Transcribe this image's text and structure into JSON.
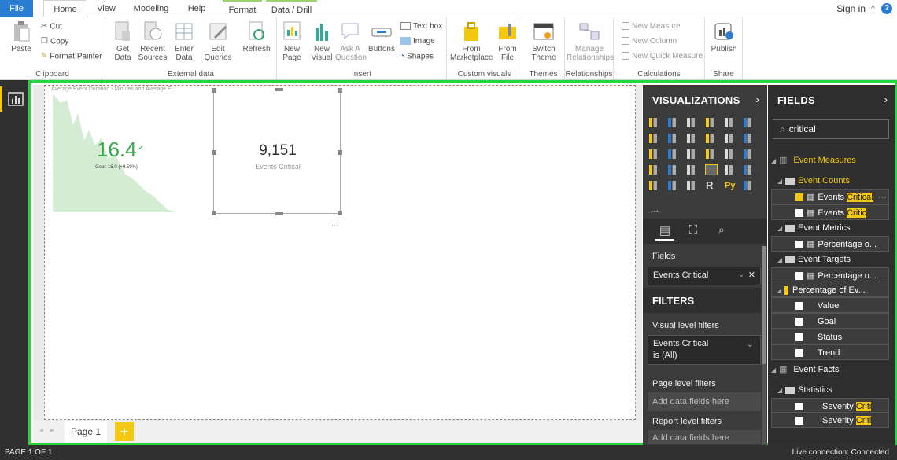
{
  "tabs": [
    "File",
    "Home",
    "View",
    "Modeling",
    "Help",
    "Format",
    "Data / Drill"
  ],
  "account": {
    "signin": "Sign in",
    "help": "?"
  },
  "ribbon": {
    "clipboard": {
      "label": "Clipboard",
      "paste": "Paste",
      "cut": "Cut",
      "copy": "Copy",
      "format_painter": "Format Painter"
    },
    "external": {
      "label": "External data",
      "get_data": "Get Data",
      "recent_sources": "Recent Sources",
      "enter_data": "Enter Data",
      "edit_queries": "Edit Queries",
      "refresh": "Refresh"
    },
    "insert": {
      "label": "Insert",
      "new_page": "New Page",
      "new_visual": "New Visual",
      "ask_question": "Ask A Question",
      "buttons": "Buttons",
      "text_box": "Text box",
      "image": "Image",
      "shapes": "Shapes"
    },
    "custom": {
      "label": "Custom visuals",
      "from_marketplace": "From Marketplace",
      "from_file": "From File"
    },
    "themes": {
      "label": "Themes",
      "switch_theme": "Switch Theme"
    },
    "relationships": {
      "label": "Relationships",
      "manage": "Manage Relationships"
    },
    "calculations": {
      "label": "Calculations",
      "new_measure": "New Measure",
      "new_column": "New Column",
      "new_quick_measure": "New Quick Measure"
    },
    "share": {
      "label": "Share",
      "publish": "Publish"
    }
  },
  "kpi": {
    "title": "Average Event Duration - Minutes and Average E...",
    "value": "16.4",
    "goal": "Goal: 15.0 (+9.59%)"
  },
  "card": {
    "value": "9,151",
    "label": "Events Critical",
    "more": "..."
  },
  "pages": {
    "page1": "Page 1",
    "add": "+"
  },
  "visualizations": {
    "title": "VISUALIZATIONS",
    "more": "...",
    "fields_label": "Fields",
    "field_value": "Events Critical",
    "filters_title": "FILTERS",
    "visual_level": "Visual level filters",
    "filter_field": "Events Critical",
    "filter_value": "is (All)",
    "page_level": "Page level filters",
    "add_data": "Add data fields here",
    "report_level": "Report level filters",
    "add_data2": "Add data fields here"
  },
  "fields": {
    "title": "FIELDS",
    "search_value": "critical",
    "event_measures": "Event Measures",
    "event_counts": "Event Counts",
    "events_prefix": "Events ",
    "events_critical_hl": "Critical",
    "events_critic_hl": "Critic",
    "event_metrics": "Event Metrics",
    "percentage_o": "Percentage o...",
    "event_targets": "Event Targets",
    "percentage_o2": "Percentage o...",
    "percentage_of_ev": "Percentage of Ev...",
    "value": "Value",
    "goal": "Goal",
    "status": "Status",
    "trend": "Trend",
    "event_facts": "Event Facts",
    "statistics": "Statistics",
    "severity_prefix": "Severity ",
    "criti_hl": "Criti"
  },
  "status": {
    "left": "PAGE 1 OF 1",
    "right": "Live connection: Connected"
  },
  "colors": {
    "accent": "#f2c811",
    "file_tab": "#2b7cd3",
    "border_green": "#27d638",
    "kpi_green": "#3aa84a"
  }
}
